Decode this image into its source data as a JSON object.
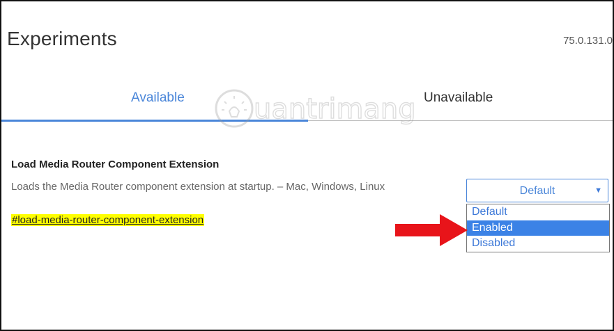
{
  "header": {
    "title": "Experiments",
    "version": "75.0.131.0"
  },
  "tabs": [
    {
      "label": "Available",
      "active": true
    },
    {
      "label": "Unavailable",
      "active": false
    }
  ],
  "watermark": {
    "text": "uantrimang"
  },
  "experiment": {
    "name": "Load Media Router Component Extension",
    "description": "Loads the Media Router component extension at startup. – Mac, Windows, Linux",
    "link": "#load-media-router-component-extension",
    "select": {
      "value": "Default",
      "options": [
        "Default",
        "Enabled",
        "Disabled"
      ],
      "highlighted": "Enabled"
    }
  },
  "colors": {
    "accent": "#4a86d9",
    "highlight": "#ffff00",
    "arrow": "#e8141a",
    "selection": "#3b82e6"
  }
}
